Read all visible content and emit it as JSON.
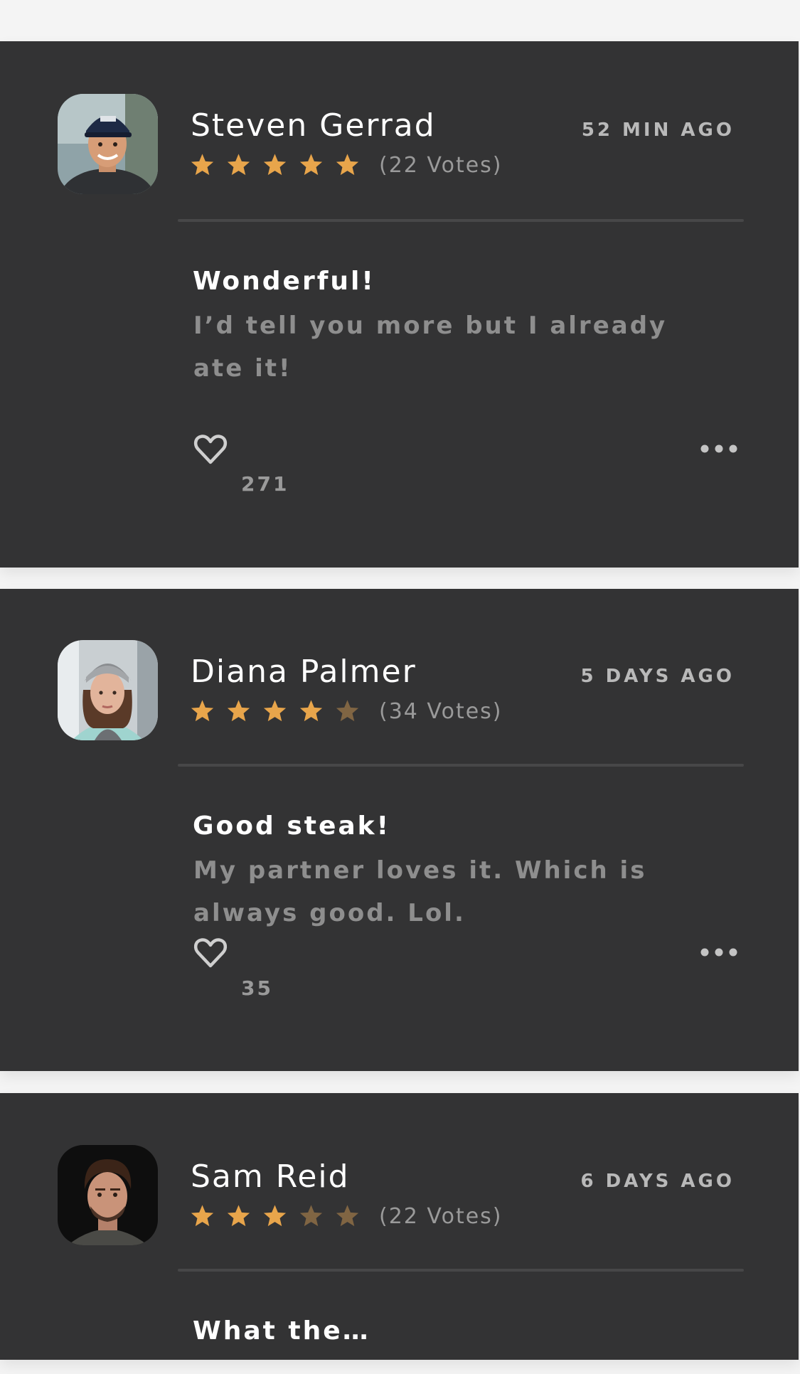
{
  "colors": {
    "card_bg": "#333334",
    "page_bg": "#f4f4f4",
    "star_full": "#e8a54b",
    "star_empty": "#806543",
    "name": "#ffffff",
    "secondary": "#9a9a9a"
  },
  "reviews": [
    {
      "name": "Steven Gerrad",
      "time": "52 MIN AGO",
      "rating": 5,
      "votes": "(22 Votes)",
      "title": "Wonderful!",
      "body": "I’d tell you more but I already ate it!",
      "likes": "271"
    },
    {
      "name": "Diana Palmer",
      "time": "5 DAYS AGO",
      "rating": 4,
      "votes": "(34 Votes)",
      "title": "Good steak!",
      "body": "My partner loves it. Which is always good. Lol.",
      "likes": "35"
    },
    {
      "name": "Sam Reid",
      "time": "6 DAYS AGO",
      "rating": 3,
      "votes": "(22 Votes)",
      "title": "What the…"
    }
  ],
  "icons": {
    "like": "heart-icon",
    "more": "more-dots-icon",
    "star": "star-icon"
  }
}
